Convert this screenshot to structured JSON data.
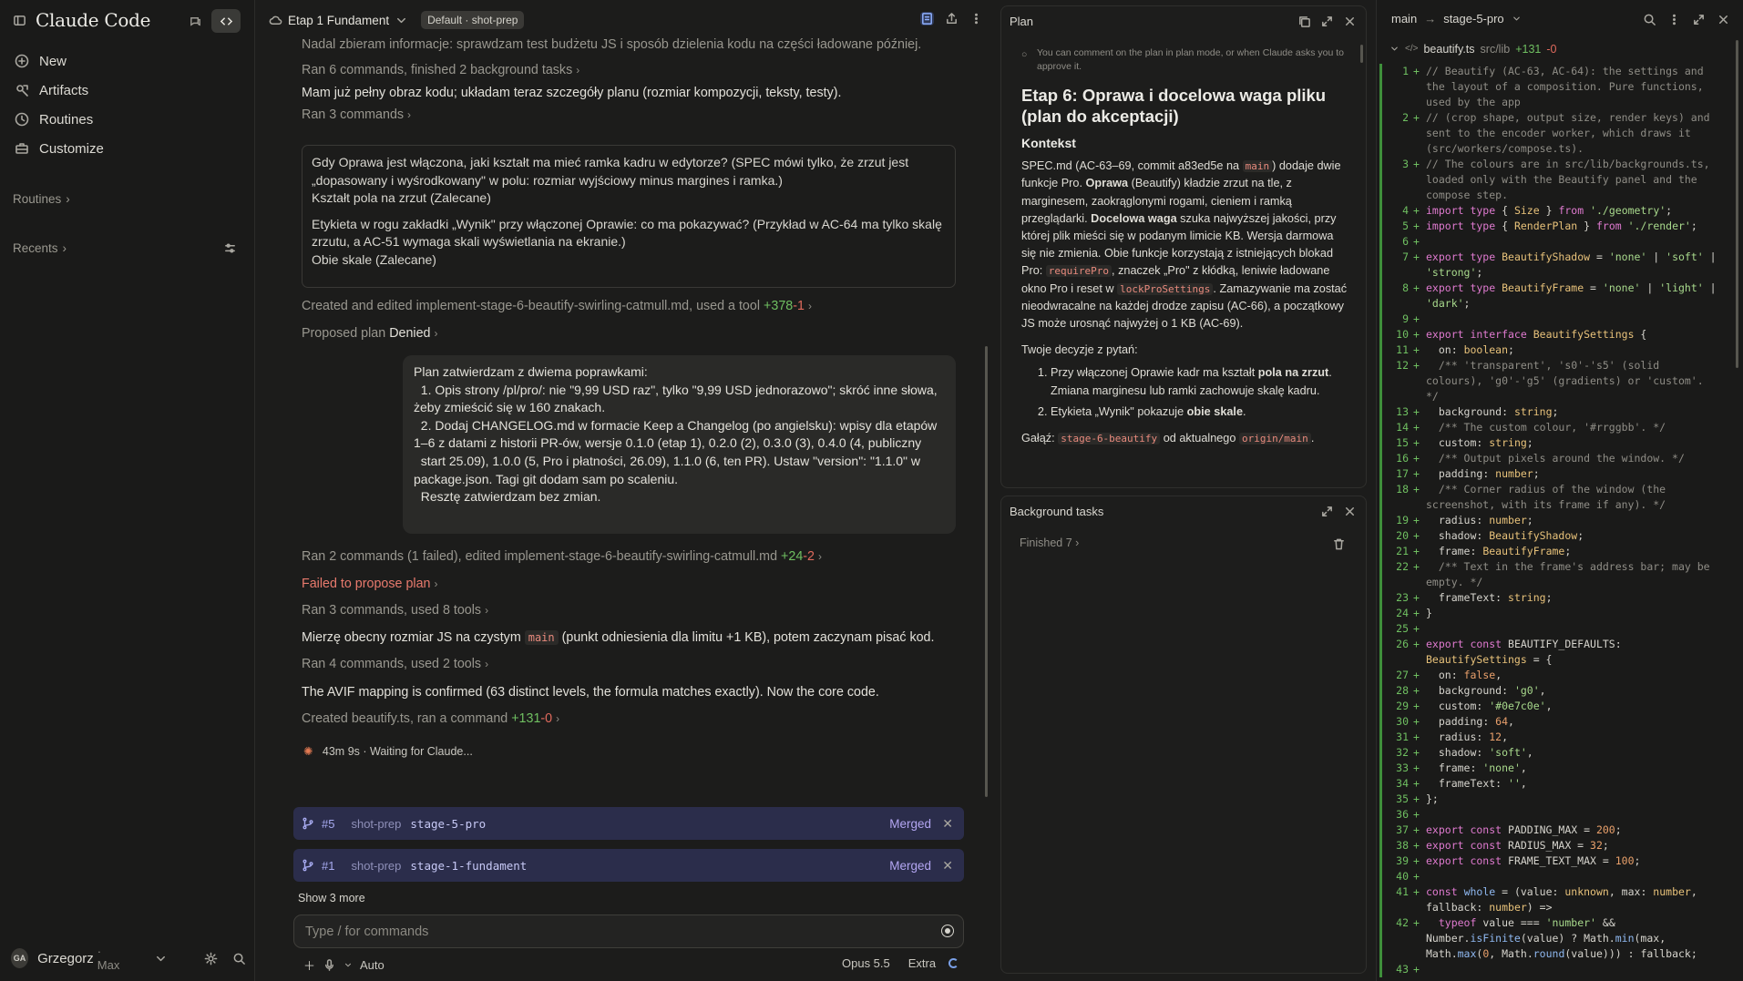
{
  "sidebar": {
    "app_title": "Claude Code",
    "nav": [
      {
        "label": "New",
        "icon": "plus-icon"
      },
      {
        "label": "Artifacts",
        "icon": "artifacts-icon"
      },
      {
        "label": "Routines",
        "icon": "clock-icon"
      },
      {
        "label": "Customize",
        "icon": "briefcase-icon"
      }
    ],
    "routines_label": "Routines",
    "recents_label": "Recents",
    "user": {
      "initials": "GA",
      "name": "Grzegorz",
      "plan": "· Max"
    }
  },
  "chat": {
    "title": "Etap 1 Fundament",
    "badge": "Default · shot-prep",
    "r1": "Nadal zbieram informacje: sprawdzam test budżetu JS i sposób dzielenia kodu na części ładowane później.",
    "r2": "Ran 6 commands, finished 2 background tasks",
    "r3": "Mam już pełny obraz kodu; układam teraz szczegóły planu (rozmiar kompozycji, teksty, testy).",
    "r4": "Ran 3 commands",
    "q1": "Gdy Oprawa jest włączona, jaki kształt ma mieć ramka kadru w edytorze? (SPEC mówi tylko, że zrzut jest „dopasowany i wyśrodkowany\" w polu: rozmiar wyjściowy minus margines i ramka.)",
    "a1": "Kształt pola na zrzut (Zalecane)",
    "q2": "Etykieta w rogu zakładki „Wynik\" przy włączonej Oprawie: co ma pokazywać? (Przykład w AC-64 ma tylko skalę zrzutu, a AC-51 wymaga skali wyświetlania na ekranie.)",
    "a2": "Obie skale (Zalecane)",
    "r5": "Created and edited implement-stage-6-beautify-swirling-catmull.md, used a tool",
    "r5_add": "+378",
    "r5_del": "-1",
    "r6": "Proposed plan",
    "r6_status": "Denied",
    "user_msg": "Plan zatwierdzam z dwiema poprawkami:\n  1. Opis strony /pl/pro/: nie \"9,99 USD raz\", tylko \"9,99 USD jednorazowo\"; skróć inne słowa, żeby zmieścić się w 160 znakach.\n  2. Dodaj CHANGELOG.md w formacie Keep a Changelog (po angielsku): wpisy dla etapów 1–6 z datami z historii PR-ów, wersje 0.1.0 (etap 1), 0.2.0 (2), 0.3.0 (3), 0.4.0 (4, publiczny\n  start 25.09), 1.0.0 (5, Pro i płatności, 26.09), 1.1.0 (6, ten PR). Ustaw \"version\": \"1.1.0\" w package.json. Tagi git dodam sam po scaleniu.\n  Resztę zatwierdzam bez zmian.",
    "r7": "Ran 2 commands (1 failed), edited implement-stage-6-beautify-swirling-catmull.md",
    "r7_add": "+24",
    "r7_del": "-2",
    "r8": "Failed to propose plan",
    "r9": "Ran 3 commands, used 8 tools",
    "r10_a": "Mierzę obecny rozmiar JS na czystym",
    "r10_code": "main",
    "r10_b": "(punkt odniesienia dla limitu +1 KB), potem zaczynam pisać kod.",
    "r11": "Ran 4 commands, used 2 tools",
    "r12": "The AVIF mapping is confirmed (63 distinct levels, the formula matches exactly). Now the core code.",
    "r13": "Created beautify.ts, ran a command",
    "r13_add": "+131",
    "r13_del": "-0",
    "status": "43m 9s · Waiting for Claude...",
    "prs": [
      {
        "num": "#5",
        "repo": "shot-prep",
        "branch": "stage-5-pro",
        "state": "Merged"
      },
      {
        "num": "#1",
        "repo": "shot-prep",
        "branch": "stage-1-fundament",
        "state": "Merged"
      }
    ],
    "show_more": "Show 3 more",
    "input_placeholder": "Type / for commands",
    "mode": "Auto",
    "model": "Opus 5.5",
    "effort": "Extra"
  },
  "plan": {
    "title": "Plan",
    "note": "You can comment on the plan in plan mode, or when Claude asks you to approve it.",
    "heading": "Etap 6: Oprawa i docelowa waga pliku (plan do akceptacji)",
    "context_title": "Kontekst",
    "p1a": "SPEC.md (AC-63–69, commit a83ed5e na ",
    "p1c1": "main",
    "p1b": ") dodaje dwie funkcje Pro. ",
    "p1s1": "Oprawa",
    "p1d": " (Beautify) kładzie zrzut na tle, z marginesem, zaokrąglonymi rogami, cieniem i ramką przeglądarki. ",
    "p1s2": "Docelowa waga",
    "p1e": " szuka najwyższej jakości, przy której plik mieści się w podanym limicie KB. Wersja darmowa się nie zmienia. Obie funkcje korzystają z istniejących blokad Pro: ",
    "p1c2": "requirePro",
    "p1f": ", znaczek „Pro\" z kłódką, leniwie ładowane okno Pro i reset w ",
    "p1c3": "lockProSettings",
    "p1g": ". Zamazywanie ma zostać nieodwracalne na każdej drodze zapisu (AC-66), a początkowy JS może urosnąć najwyżej o 1 KB (AC-69).",
    "decisions_title": "Twoje decyzje z pytań:",
    "d1a": "Przy włączonej Oprawie kadr ma kształt ",
    "d1s": "pola na zrzut",
    "d1b": ". Zmiana marginesu lub ramki zachowuje skalę kadru.",
    "d2a": "Etykieta „Wynik\" pokazuje ",
    "d2s": "obie skale",
    "d2b": ".",
    "branch_a": "Gałąź: ",
    "branch_c1": "stage-6-beautify",
    "branch_b": " od aktualnego ",
    "branch_c2": "origin/main",
    "branch_d": ".",
    "bg_title": "Background tasks",
    "bg_finished": "Finished 7"
  },
  "diff": {
    "branch": "main",
    "target": "stage-5-pro",
    "file": "beautify.ts",
    "path": "src/lib",
    "add": "+131",
    "del": "-0"
  },
  "colors": {
    "accent": "#b3a6f2",
    "add": "#6fbf61",
    "del": "#e06a5d",
    "spark": "#e37a52"
  }
}
